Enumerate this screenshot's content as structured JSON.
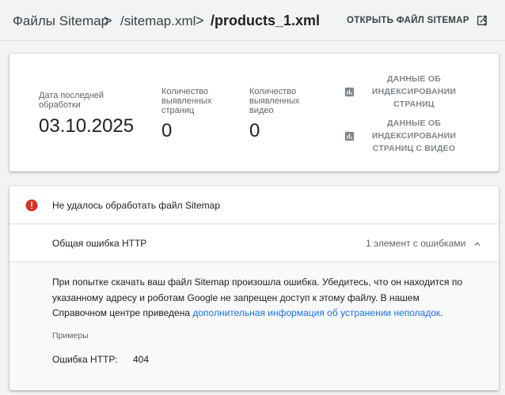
{
  "header": {
    "breadcrumb_root": "Файлы Sitemap",
    "breadcrumb_sitemap": "/sitemap.xml",
    "breadcrumb_current": "/products_1.xml",
    "separator": ">",
    "open_sitemap_label": "ОТКРЫТЬ ФАЙЛ SITEMAP",
    "open_icon": "open-in-new-icon",
    "more_icon": "more-vert-icon"
  },
  "stats": {
    "last_processed_label": "Дата последней обработки",
    "last_processed_value": "03.10.2025",
    "pages_found_label": "Количество выявленных страниц",
    "pages_found_value": "0",
    "videos_found_label": "Количество выявленных видео",
    "videos_found_value": "0",
    "page_indexing_link": "ДАННЫЕ ОБ ИНДЕКСИРОВАНИИ СТРАНИЦ",
    "video_indexing_link": "ДАННЫЕ ОБ ИНДЕКСИРОВАНИИ СТРАНИЦ С ВИДЕО",
    "link_icon": "bar-chart-icon"
  },
  "error": {
    "title": "Не удалось обработать файл Sitemap",
    "icon": "error-icon",
    "http_error_title": "Общая ошибка HTTP",
    "http_error_count": "1 элемент с ошибками",
    "description_prefix": "При попытке скачать ваш файл Sitemap произошла ошибка. Убедитесь, что он находится по указанному адресу и роботам Google не запрещен доступ к этому файлу. В нашем Справочном центре приведена ",
    "description_link": "дополнительная информация об устранении неполадок",
    "description_suffix": ".",
    "examples_label": "Примеры",
    "example_key": "Ошибка HTTP:",
    "example_value": "404"
  },
  "colors": {
    "background": "#f1f3f4",
    "card": "#ffffff",
    "error_red": "#d93025",
    "link_blue": "#1a73e8",
    "muted_text": "#5f6368"
  }
}
